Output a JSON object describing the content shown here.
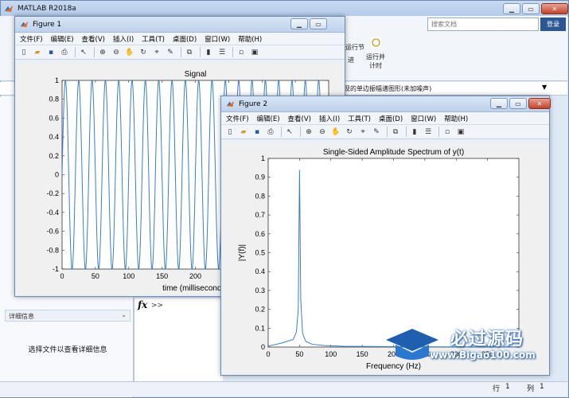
{
  "main": {
    "title": "MATLAB R2018a",
    "search_placeholder": "搜索文档",
    "login_label": "登录",
    "ribbon_run_section": "运行节",
    "ribbon_advance": "进",
    "ribbon_run_time": "运行并\n计时",
    "path_text": "现的单边振幅谱图形(未加噪声)",
    "detail_header": "详细信息",
    "detail_text": "选择文件以查看详细信息",
    "cmd_prompt": ">>",
    "status_row_label": "行",
    "status_row": "1",
    "status_col_label": "列",
    "status_col": "1"
  },
  "figure1": {
    "title": "Figure 1",
    "menu": [
      "文件(F)",
      "编辑(E)",
      "查看(V)",
      "插入(I)",
      "工具(T)",
      "桌面(D)",
      "窗口(W)",
      "帮助(H)"
    ],
    "chart_data": {
      "type": "line",
      "title": "Signal",
      "xlabel": "time (milliseconds)",
      "ylabel": "",
      "xlim": [
        0,
        400
      ],
      "ylim": [
        -1,
        1
      ],
      "xticks": [
        0,
        50,
        100,
        150,
        200,
        250,
        300,
        350
      ],
      "yticks": [
        1,
        0.8,
        0.6,
        0.4,
        0.2,
        0,
        -0.2,
        -0.4,
        -0.6,
        -0.8,
        -1
      ],
      "series": [
        {
          "function": "sin(2*pi*50*t)",
          "frequency_hz": 50,
          "amplitude": 1,
          "x_start": 0,
          "x_end": 400
        }
      ],
      "color": "#3a7fc6"
    }
  },
  "figure2": {
    "title": "Figure 2",
    "menu": [
      "文件(F)",
      "编辑(E)",
      "查看(V)",
      "插入(I)",
      "工具(T)",
      "桌面(D)",
      "窗口(W)",
      "帮助(H)"
    ],
    "chart_data": {
      "type": "line",
      "title": "Single-Sided Amplitude Spectrum of y(t)",
      "xlabel": "Frequency (Hz)",
      "ylabel": "|Y(f)|",
      "xlim": [
        0,
        400
      ],
      "ylim": [
        0,
        1
      ],
      "xticks": [
        0,
        50,
        100,
        150,
        200,
        250,
        300,
        350
      ],
      "yticks": [
        1,
        0.9,
        0.8,
        0.7,
        0.6,
        0.5,
        0.4,
        0.3,
        0.2,
        0.1,
        0
      ],
      "series": [
        {
          "x": [
            0,
            20,
            30,
            40,
            45,
            48,
            50,
            52,
            55,
            60,
            70,
            90,
            120,
            200,
            300,
            400
          ],
          "y": [
            0.005,
            0.02,
            0.03,
            0.04,
            0.08,
            0.2,
            0.94,
            0.25,
            0.07,
            0.03,
            0.015,
            0.008,
            0.004,
            0.002,
            0.001,
            0.001
          ]
        }
      ],
      "color": "#3a7fc6"
    }
  },
  "watermark": {
    "cn": "必过源码",
    "en": "www.Bigao100.com"
  }
}
